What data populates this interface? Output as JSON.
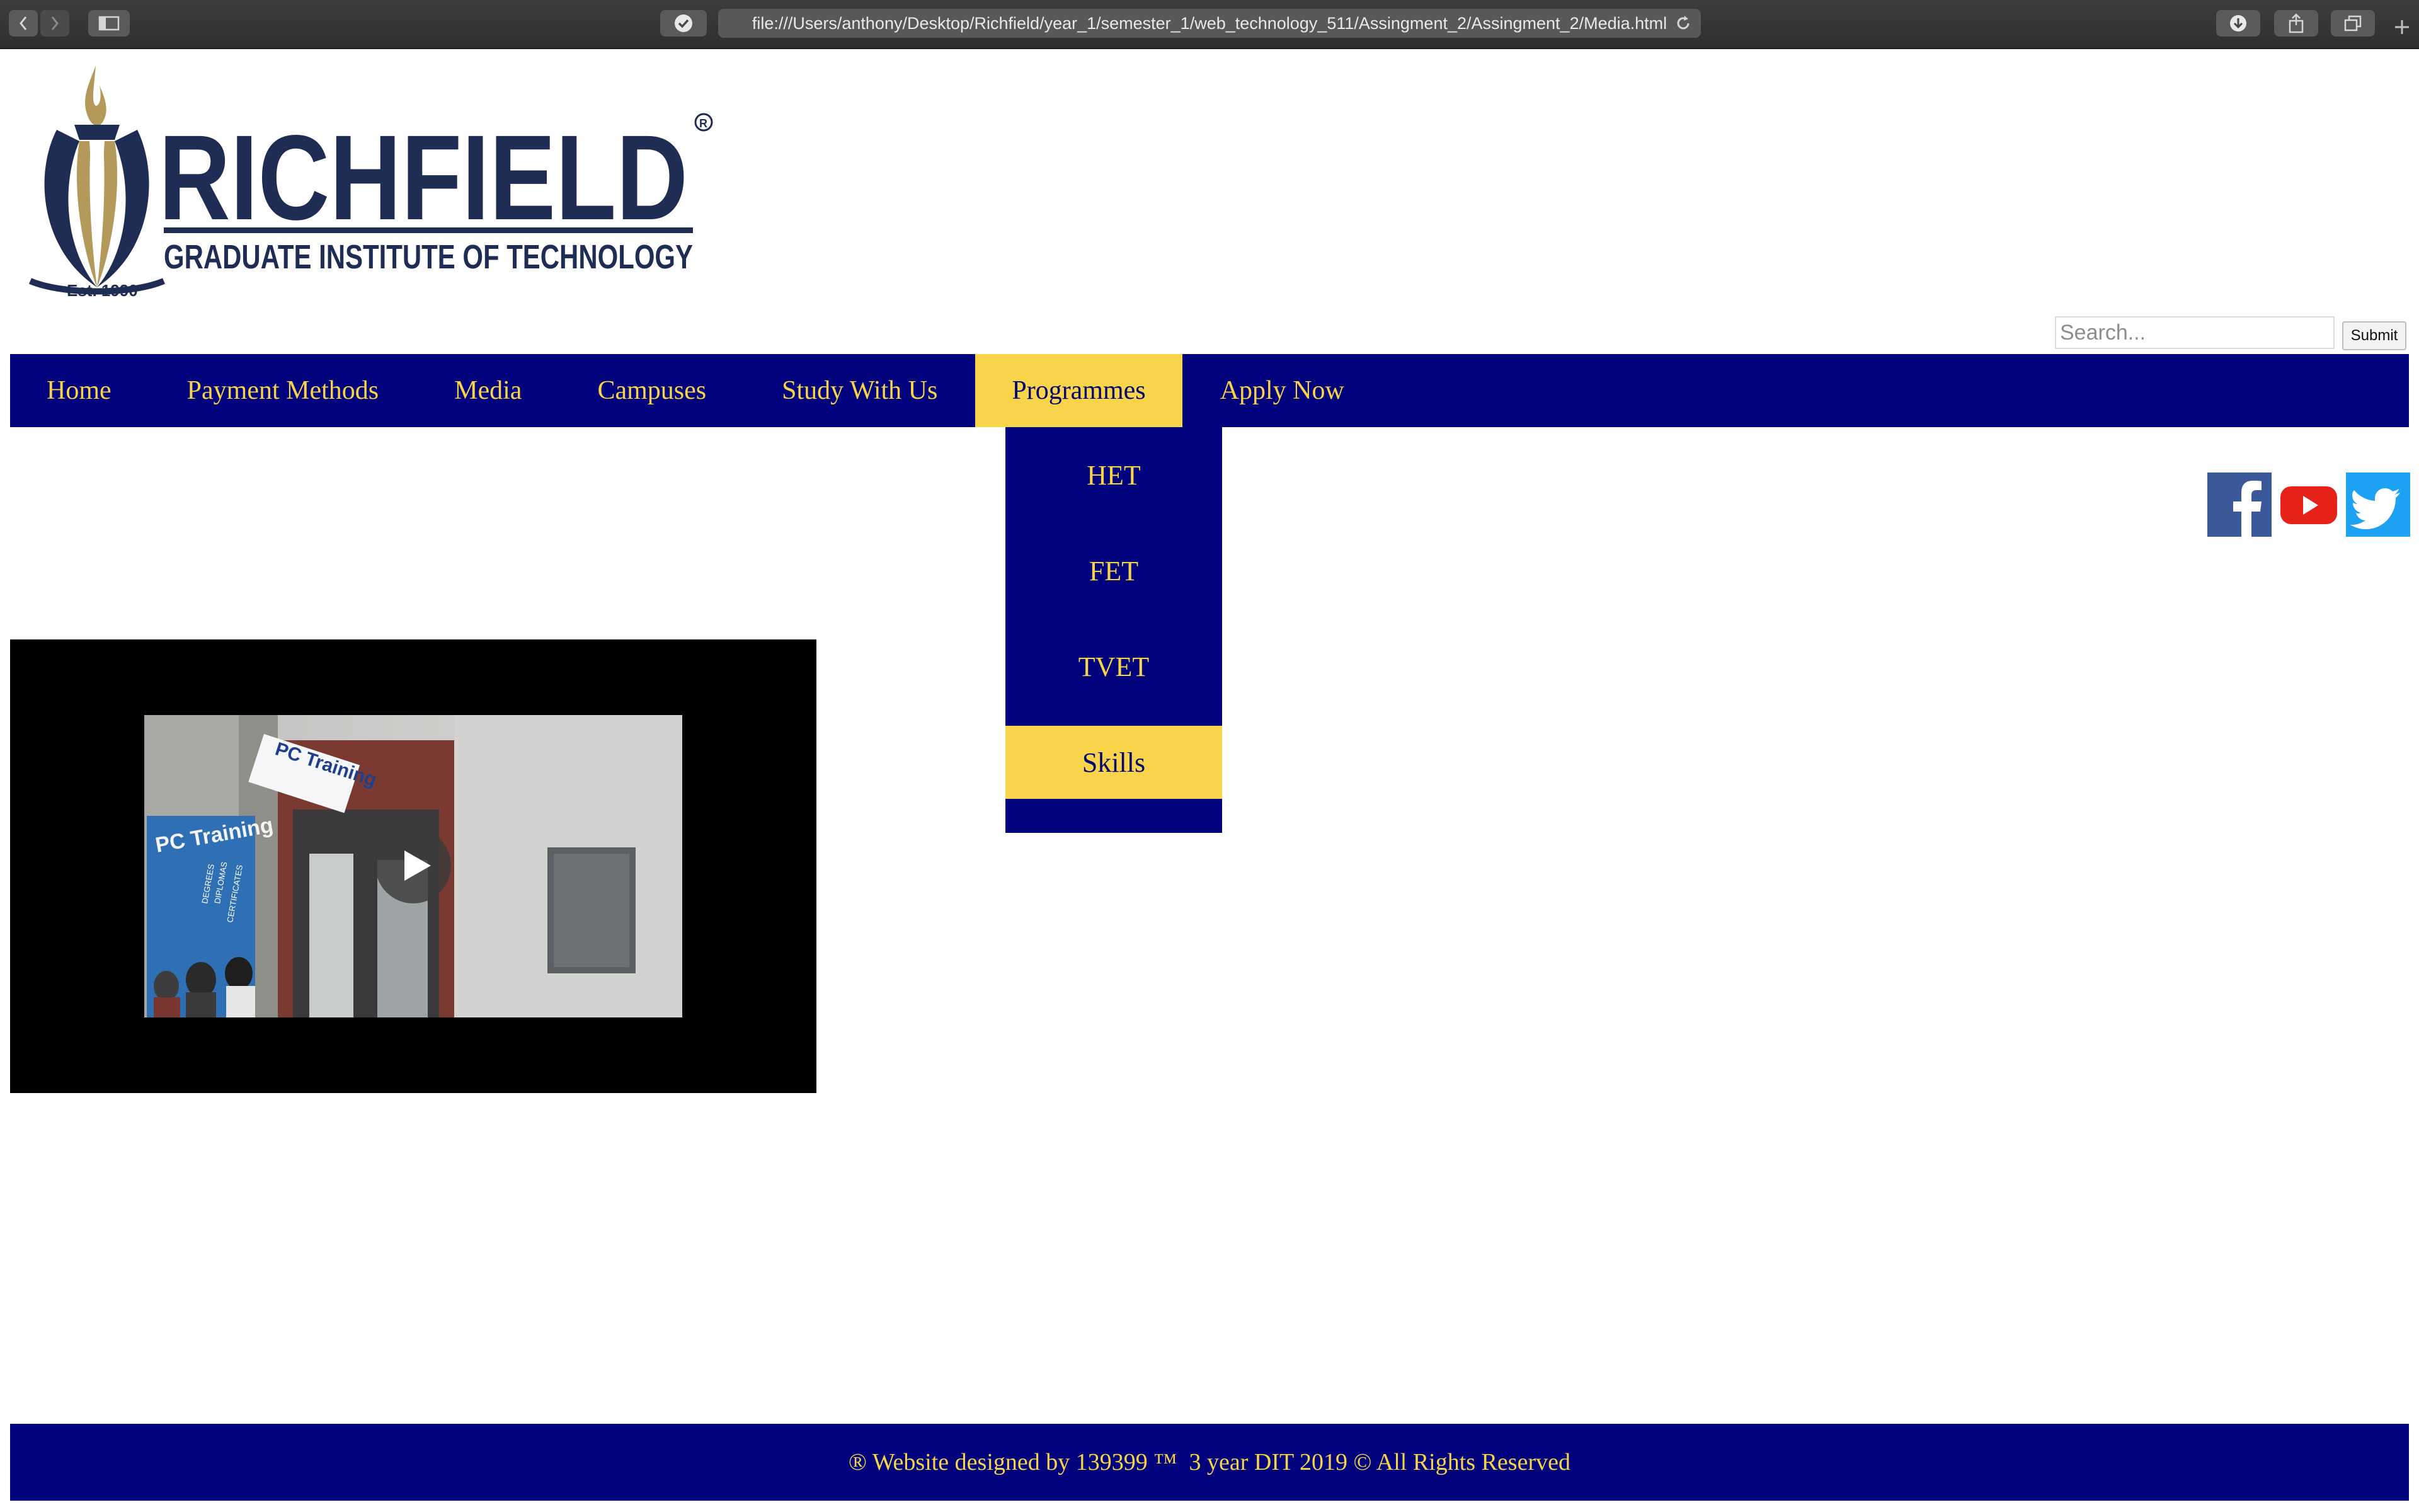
{
  "browser": {
    "url": "file:///Users/anthony/Desktop/Richfield/year_1/semester_1/web_technology_511/Assingment_2/Assingment_2/Media.html",
    "icons": [
      "back-icon",
      "forward-icon",
      "sidebar-icon",
      "shield-check-icon",
      "reload-icon",
      "download-icon",
      "share-icon",
      "tabs-icon",
      "new-tab-icon"
    ]
  },
  "logo": {
    "name": "RICHFIELD",
    "tagline": "GRADUATE INSTITUTE OF TECHNOLOGY",
    "established": "Est. 1990",
    "registered_mark": "R"
  },
  "search": {
    "placeholder": "Search...",
    "submit_label": "Submit"
  },
  "nav": {
    "items": [
      {
        "label": "Home"
      },
      {
        "label": "Payment Methods"
      },
      {
        "label": "Media"
      },
      {
        "label": "Campuses"
      },
      {
        "label": "Study With Us"
      },
      {
        "label": "Programmes",
        "active": true
      },
      {
        "label": "Apply Now"
      }
    ]
  },
  "dropdown": {
    "items": [
      {
        "label": "HET"
      },
      {
        "label": "FET"
      },
      {
        "label": "TVET"
      },
      {
        "label": "Skills",
        "active": true
      }
    ]
  },
  "video": {
    "sign_text": "PC Training",
    "poster_text": "PC Training",
    "poster_lines": [
      "DEGREES",
      "DIPLOMAS",
      "CERTIFICATES"
    ]
  },
  "social": [
    "facebook-icon",
    "youtube-icon",
    "twitter-icon"
  ],
  "footer": {
    "text": "® Website designed by 139399 ™  3 year DIT 2019 © All Rights Reserved"
  },
  "colors": {
    "nav_bg": "#02027d",
    "nav_text": "#f7d34c",
    "accent_yellow": "#f7d44a",
    "logo_navy": "#1f2d54",
    "logo_gold": "#b39a5b",
    "facebook": "#3b5998",
    "youtube": "#e62117",
    "twitter": "#1da1f2"
  }
}
